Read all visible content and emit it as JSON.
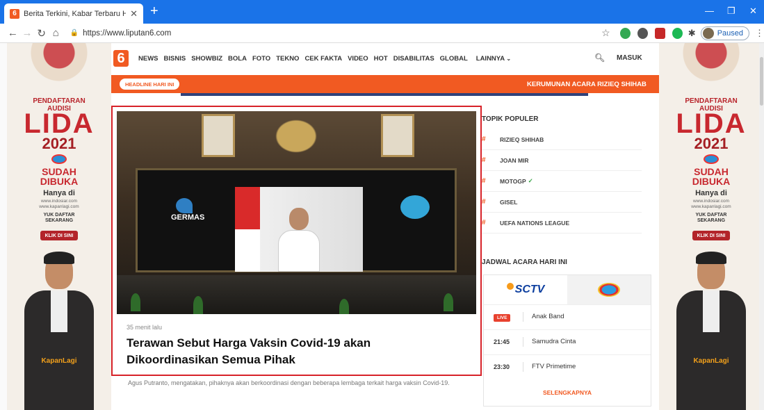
{
  "browser": {
    "tab_title": "Berita Terkini, Kabar Terbaru Hari Ini",
    "tab_favicon": "6",
    "url": "https://www.liputan6.com",
    "profile_status": "Paused"
  },
  "site": {
    "logo": "6",
    "nav": [
      "NEWS",
      "BISNIS",
      "SHOWBIZ",
      "BOLA",
      "FOTO",
      "TEKNO",
      "CEK FAKTA",
      "VIDEO",
      "HOT",
      "DISABILITAS",
      "GLOBAL",
      "LAINNYA"
    ],
    "login_label": "MASUK",
    "headline_tag": "HEADLINE HARI INI",
    "headline_text": "KERUMUNAN ACARA RIZIEQ SHIHAB",
    "accent_color": "#f15a22"
  },
  "article": {
    "time": "35 menit lalu",
    "title": "Terawan Sebut Harga Vaksin Covid-19 akan Dikoordinasikan Semua Pihak",
    "excerpt": "Agus Putranto, mengatakan, pihaknya akan berkoordinasi dengan beberapa lembaga terkait harga vaksin Covid-19.",
    "image_text": "GERMAS"
  },
  "sidebar": {
    "topik_title": "TOPIK POPULER",
    "topics": [
      {
        "label": "RIZIEQ SHIHAB",
        "verified": false
      },
      {
        "label": "JOAN MIR",
        "verified": false
      },
      {
        "label": "MOTOGP",
        "verified": true
      },
      {
        "label": "GISEL",
        "verified": false
      },
      {
        "label": "UEFA NATIONS LEAGUE",
        "verified": false
      }
    ],
    "jadwal_title": "JADWAL ACARA HARI INI",
    "channel_active": "SCTV",
    "schedule": [
      {
        "time": "LIVE",
        "is_live": true,
        "program": "Anak Band"
      },
      {
        "time": "21:45",
        "is_live": false,
        "program": "Samudra Cinta"
      },
      {
        "time": "23:30",
        "is_live": false,
        "program": "FTV Primetime"
      }
    ],
    "more_label": "SELENGKAPNYA"
  },
  "ads": {
    "line1": "PENDAFTARAN\nAUDISI",
    "lida": "LIDA",
    "year": "2021",
    "sudah": "SUDAH\nDIBUKA",
    "hanya": "Hanya di",
    "urls": "www.indosiar.com\nwww.kapanlagi.com",
    "yuk": "YUK DAFTAR\nSEKARANG",
    "klik": "KLIK DI SINI",
    "brand": "KapanLagi"
  }
}
